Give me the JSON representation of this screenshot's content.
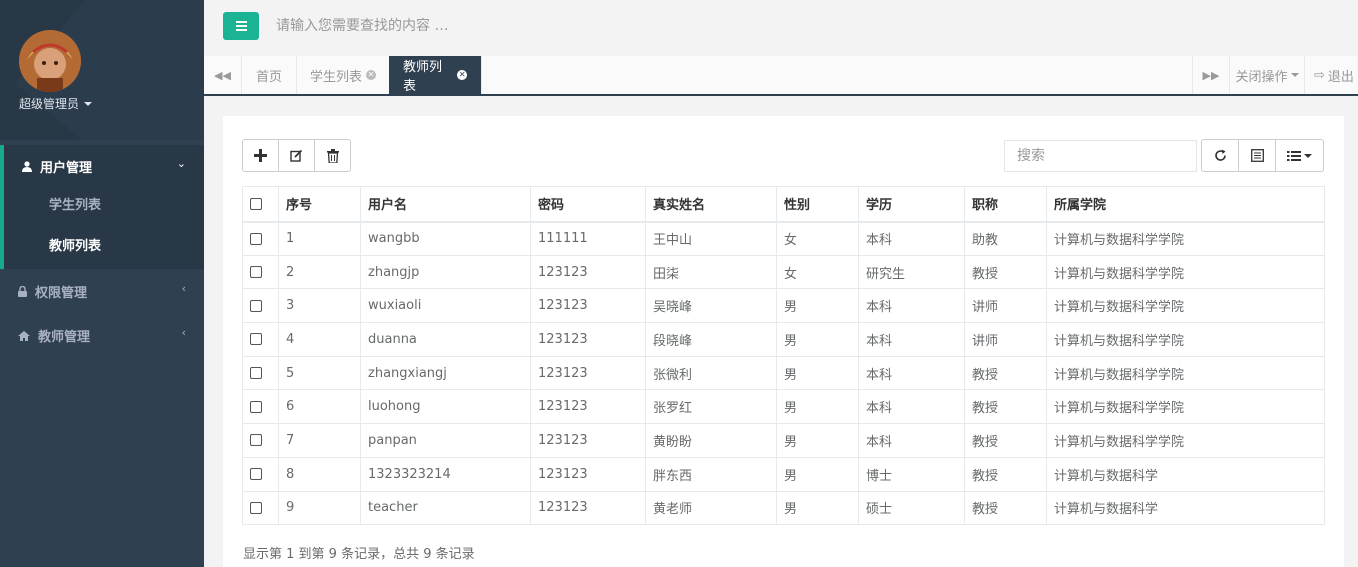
{
  "sidebar": {
    "user": "超级管理员",
    "groups": [
      {
        "label": "用户管理",
        "items": [
          "学生列表",
          "教师列表"
        ]
      },
      {
        "label": "权限管理"
      },
      {
        "label": "教师管理"
      }
    ],
    "accent": "#19aa8d"
  },
  "header": {
    "search_placeholder": "请输入您需要查找的内容 …"
  },
  "tabs": {
    "items": [
      "首页",
      "学生列表",
      "教师列表"
    ],
    "close_ops": "关闭操作",
    "logout": "退出"
  },
  "toolbar": {
    "search_placeholder": "搜索"
  },
  "table": {
    "headers": [
      "序号",
      "用户名",
      "密码",
      "真实姓名",
      "性别",
      "学历",
      "职称",
      "所属学院"
    ],
    "rows": [
      [
        "1",
        "wangbb",
        "111111",
        "王中山",
        "女",
        "本科",
        "助教",
        "计算机与数据科学学院"
      ],
      [
        "2",
        "zhangjp",
        "123123",
        "田柒",
        "女",
        "研究生",
        "教授",
        "计算机与数据科学学院"
      ],
      [
        "3",
        "wuxiaoli",
        "123123",
        "吴晓峰",
        "男",
        "本科",
        "讲师",
        "计算机与数据科学学院"
      ],
      [
        "4",
        "duanna",
        "123123",
        "段晓峰",
        "男",
        "本科",
        "讲师",
        "计算机与数据科学学院"
      ],
      [
        "5",
        "zhangxiangj",
        "123123",
        "张微利",
        "男",
        "本科",
        "教授",
        "计算机与数据科学学院"
      ],
      [
        "6",
        "luohong",
        "123123",
        "张罗红",
        "男",
        "本科",
        "教授",
        "计算机与数据科学学院"
      ],
      [
        "7",
        "panpan",
        "123123",
        "黄盼盼",
        "男",
        "本科",
        "教授",
        "计算机与数据科学学院"
      ],
      [
        "8",
        "1323323214",
        "123123",
        "胖东西",
        "男",
        "博士",
        "教授",
        "计算机与数据科学"
      ],
      [
        "9",
        "teacher",
        "123123",
        "黄老师",
        "男",
        "硕士",
        "教授",
        "计算机与数据科学"
      ]
    ]
  },
  "footer": {
    "info": "显示第 1 到第 9 条记录，总共 9 条记录"
  }
}
